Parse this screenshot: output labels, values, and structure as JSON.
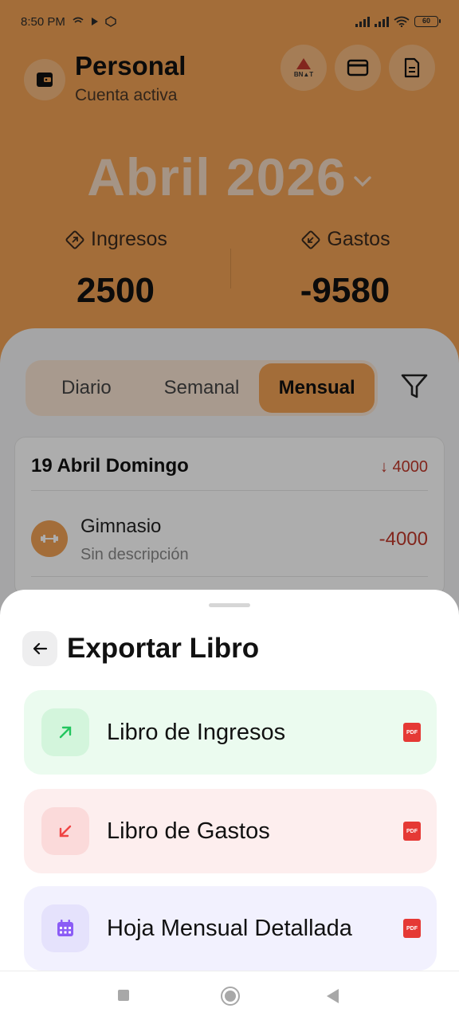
{
  "status_bar": {
    "time": "8:50 PM",
    "battery": "60"
  },
  "header": {
    "account_name": "Personal",
    "account_status": "Cuenta activa",
    "bnat_label": "BN▲T"
  },
  "summary": {
    "month": "Abril 2026",
    "income_label": "Ingresos",
    "income_value": "2500",
    "expense_label": "Gastos",
    "expense_value": "-9580"
  },
  "period_tabs": {
    "items": [
      "Diario",
      "Semanal",
      "Mensual"
    ],
    "selected": "Mensual"
  },
  "day_group": {
    "date": "19 Abril Domingo",
    "total": "4000",
    "transaction": {
      "title": "Gimnasio",
      "description": "Sin descripción",
      "amount": "-4000"
    }
  },
  "export_sheet": {
    "title": "Exportar Libro",
    "options": [
      {
        "label": "Libro de Ingresos",
        "badge": "PDF",
        "color": "#22c55e"
      },
      {
        "label": "Libro de Gastos",
        "badge": "PDF",
        "color": "#ef4444"
      },
      {
        "label": "Hoja Mensual Detallada",
        "badge": "PDF",
        "color": "#8b5cf6"
      }
    ]
  },
  "colors": {
    "accent": "#f0a154",
    "income": "#22c55e",
    "expense": "#c0392b"
  }
}
